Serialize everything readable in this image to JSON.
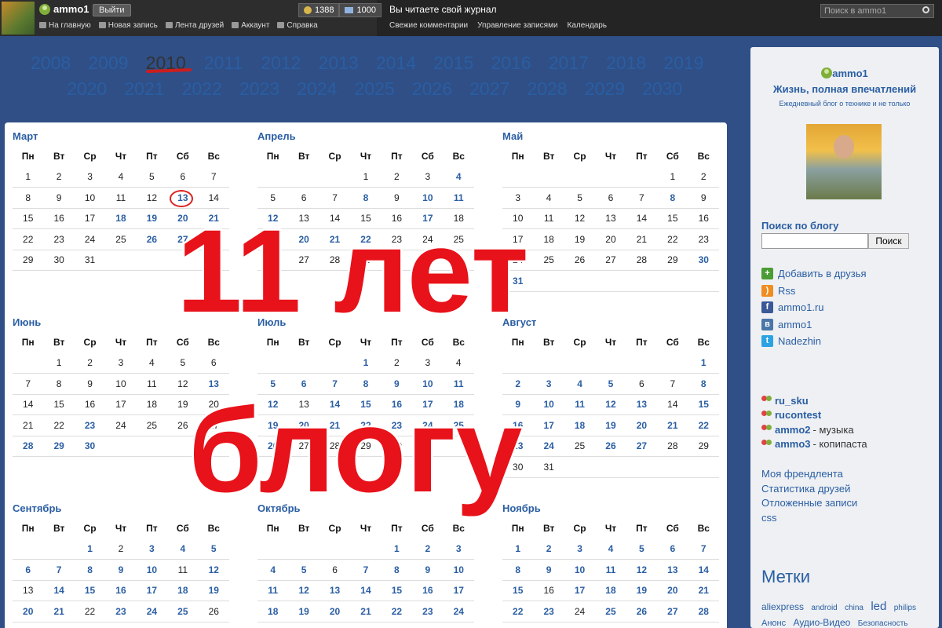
{
  "topbar": {
    "username": "ammo1",
    "logout": "Выйти",
    "coins": "1388",
    "messages": "1000",
    "nav": [
      "На главную",
      "Новая запись",
      "Лента друзей",
      "Аккаунт",
      "Справка"
    ],
    "reading": "Вы читаете свой журнал",
    "nav2": [
      "Свежие комментарии",
      "Управление записями",
      "Календарь"
    ],
    "search_placeholder": "Поиск в ammo1"
  },
  "years_row1": [
    "2008",
    "2009",
    "2010",
    "2011",
    "2012",
    "2013",
    "2014",
    "2015",
    "2016",
    "2017",
    "2018",
    "2019"
  ],
  "years_row2": [
    "2020",
    "2021",
    "2022",
    "2023",
    "2024",
    "2025",
    "2026",
    "2027",
    "2028",
    "2029",
    "2030"
  ],
  "current_year": "2010",
  "weekdays": [
    "Пн",
    "Вт",
    "Ср",
    "Чт",
    "Пт",
    "Сб",
    "Вс"
  ],
  "months": [
    {
      "name": "Март",
      "rows": [
        [
          "1",
          "2",
          "3",
          "4",
          "5",
          "6",
          "7"
        ],
        [
          "8",
          "9",
          "10",
          "11",
          "12",
          "13",
          "14"
        ],
        [
          "15",
          "16",
          "17",
          "18",
          "19",
          "20",
          "21"
        ],
        [
          "22",
          "23",
          "24",
          "25",
          "26",
          "27",
          "28"
        ],
        [
          "29",
          "30",
          "31",
          "",
          "",
          "",
          ""
        ]
      ],
      "linked": [
        "13",
        "18",
        "19",
        "20",
        "21",
        "26",
        "27"
      ]
    },
    {
      "name": "Апрель",
      "rows": [
        [
          "",
          "",
          "",
          "1",
          "2",
          "3",
          "4"
        ],
        [
          "5",
          "6",
          "7",
          "8",
          "9",
          "10",
          "11"
        ],
        [
          "12",
          "13",
          "14",
          "15",
          "16",
          "17",
          "18"
        ],
        [
          "19",
          "20",
          "21",
          "22",
          "23",
          "24",
          "25"
        ],
        [
          "26",
          "27",
          "28",
          "29",
          "30",
          "",
          ""
        ]
      ],
      "linked": [
        "4",
        "8",
        "10",
        "11",
        "12",
        "17",
        "20",
        "21",
        "22"
      ]
    },
    {
      "name": "Май",
      "rows": [
        [
          "",
          "",
          "",
          "",
          "",
          "1",
          "2"
        ],
        [
          "3",
          "4",
          "5",
          "6",
          "7",
          "8",
          "9"
        ],
        [
          "10",
          "11",
          "12",
          "13",
          "14",
          "15",
          "16"
        ],
        [
          "17",
          "18",
          "19",
          "20",
          "21",
          "22",
          "23"
        ],
        [
          "24",
          "25",
          "26",
          "27",
          "28",
          "29",
          "30"
        ],
        [
          "31",
          "",
          "",
          "",
          "",
          "",
          ""
        ]
      ],
      "linked": [
        "8",
        "30",
        "31"
      ]
    },
    {
      "name": "Июнь",
      "rows": [
        [
          "",
          "1",
          "2",
          "3",
          "4",
          "5",
          "6"
        ],
        [
          "7",
          "8",
          "9",
          "10",
          "11",
          "12",
          "13"
        ],
        [
          "14",
          "15",
          "16",
          "17",
          "18",
          "19",
          "20"
        ],
        [
          "21",
          "22",
          "23",
          "24",
          "25",
          "26",
          "27"
        ],
        [
          "28",
          "29",
          "30",
          "",
          "",
          "",
          ""
        ]
      ],
      "linked": [
        "13",
        "23",
        "28",
        "29",
        "30"
      ]
    },
    {
      "name": "Июль",
      "rows": [
        [
          "",
          "",
          "",
          "1",
          "2",
          "3",
          "4"
        ],
        [
          "5",
          "6",
          "7",
          "8",
          "9",
          "10",
          "11"
        ],
        [
          "12",
          "13",
          "14",
          "15",
          "16",
          "17",
          "18"
        ],
        [
          "19",
          "20",
          "21",
          "22",
          "23",
          "24",
          "25"
        ],
        [
          "26",
          "27",
          "28",
          "29",
          "30",
          "31",
          ""
        ]
      ],
      "linked": [
        "1",
        "5",
        "6",
        "7",
        "8",
        "9",
        "10",
        "11",
        "12",
        "14",
        "15",
        "16",
        "17",
        "18",
        "19",
        "20",
        "21",
        "22",
        "23",
        "24",
        "25",
        "26",
        "31"
      ]
    },
    {
      "name": "Август",
      "rows": [
        [
          "",
          "",
          "",
          "",
          "",
          "",
          "1"
        ],
        [
          "2",
          "3",
          "4",
          "5",
          "6",
          "7",
          "8"
        ],
        [
          "9",
          "10",
          "11",
          "12",
          "13",
          "14",
          "15"
        ],
        [
          "16",
          "17",
          "18",
          "19",
          "20",
          "21",
          "22"
        ],
        [
          "23",
          "24",
          "25",
          "26",
          "27",
          "28",
          "29"
        ],
        [
          "30",
          "31",
          "",
          "",
          "",
          "",
          ""
        ]
      ],
      "linked": [
        "1",
        "2",
        "3",
        "4",
        "5",
        "8",
        "9",
        "10",
        "11",
        "12",
        "13",
        "15",
        "16",
        "17",
        "18",
        "19",
        "20",
        "21",
        "22",
        "23",
        "24",
        "26",
        "27"
      ]
    },
    {
      "name": "Сентябрь",
      "rows": [
        [
          "",
          "",
          "1",
          "2",
          "3",
          "4",
          "5"
        ],
        [
          "6",
          "7",
          "8",
          "9",
          "10",
          "11",
          "12"
        ],
        [
          "13",
          "14",
          "15",
          "16",
          "17",
          "18",
          "19"
        ],
        [
          "20",
          "21",
          "22",
          "23",
          "24",
          "25",
          "26"
        ]
      ],
      "linked": [
        "1",
        "3",
        "4",
        "5",
        "6",
        "7",
        "8",
        "9",
        "10",
        "12",
        "14",
        "15",
        "16",
        "17",
        "18",
        "19",
        "20",
        "21",
        "23",
        "24",
        "25"
      ]
    },
    {
      "name": "Октябрь",
      "rows": [
        [
          "",
          "",
          "",
          "",
          "1",
          "2",
          "3"
        ],
        [
          "4",
          "5",
          "6",
          "7",
          "8",
          "9",
          "10"
        ],
        [
          "11",
          "12",
          "13",
          "14",
          "15",
          "16",
          "17"
        ],
        [
          "18",
          "19",
          "20",
          "21",
          "22",
          "23",
          "24"
        ]
      ],
      "linked": [
        "1",
        "2",
        "3",
        "4",
        "5",
        "7",
        "8",
        "9",
        "10",
        "11",
        "12",
        "13",
        "14",
        "15",
        "16",
        "17",
        "18",
        "19",
        "20",
        "21",
        "22",
        "23",
        "24"
      ]
    },
    {
      "name": "Ноябрь",
      "rows": [
        [
          "1",
          "2",
          "3",
          "4",
          "5",
          "6",
          "7"
        ],
        [
          "8",
          "9",
          "10",
          "11",
          "12",
          "13",
          "14"
        ],
        [
          "15",
          "16",
          "17",
          "18",
          "19",
          "20",
          "21"
        ],
        [
          "22",
          "23",
          "24",
          "25",
          "26",
          "27",
          "28"
        ]
      ],
      "linked": [
        "1",
        "2",
        "3",
        "4",
        "5",
        "6",
        "7",
        "8",
        "9",
        "10",
        "11",
        "12",
        "13",
        "14",
        "15",
        "17",
        "18",
        "19",
        "20",
        "21",
        "22",
        "23",
        "25",
        "26",
        "27",
        "28"
      ]
    }
  ],
  "overlay": {
    "line1": "11 лет",
    "line2": "блогу"
  },
  "sidebar": {
    "username": "ammo1",
    "tagline": "Жизнь, полная впечатлений",
    "subtitle": "Ежедневный блог о технике и не только",
    "search_heading": "Поиск по блогу",
    "search_button": "Поиск",
    "links": [
      "Добавить в друзья",
      "Rss",
      "ammo1.ru",
      "ammo1",
      "Nadezhin"
    ],
    "communities": [
      {
        "name": "ru_sku",
        "desc": ""
      },
      {
        "name": "rucontest",
        "desc": ""
      },
      {
        "name": "ammo2",
        "desc": " - музыка"
      },
      {
        "name": "ammo3",
        "desc": " - копипаста"
      }
    ],
    "misc": [
      "Моя френдлента",
      "Статистика друзей",
      "Отложенные записи",
      "css"
    ],
    "tags_heading": "Метки",
    "tags": [
      "aliexpress",
      "android",
      "china",
      "led",
      "philips",
      "Анонс",
      "Аудио-Видео",
      "Безопасность"
    ]
  }
}
